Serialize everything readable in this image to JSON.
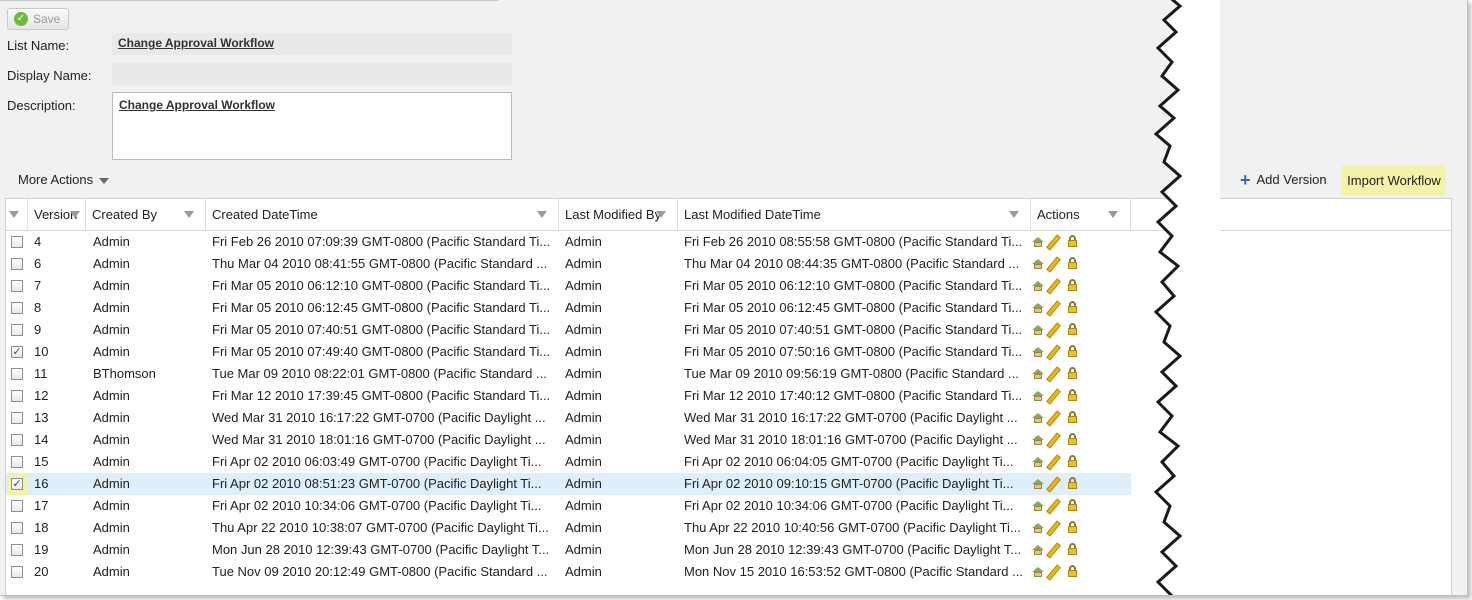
{
  "toolbar": {
    "save_label": "Save"
  },
  "form": {
    "list_name_label": "List Name:",
    "list_name_value": "Change Approval Workflow",
    "display_name_label": "Display Name:",
    "display_name_value": "",
    "description_label": "Description:",
    "description_value": "Change Approval Workflow"
  },
  "actions_bar": {
    "more_actions": "More Actions",
    "add_version": "Add Version",
    "import_workflow": "Import Workflow"
  },
  "grid": {
    "columns": [
      "Version",
      "Created By",
      "Created DateTime",
      "Last Modified By",
      "Last Modified DateTime",
      "Actions"
    ],
    "rows": [
      {
        "checked": false,
        "version": "4",
        "created_by": "Admin",
        "created": "Fri Feb 26 2010 07:09:39 GMT-0800 (Pacific Standard Ti...",
        "modified_by": "Admin",
        "modified": "Fri Feb 26 2010 08:55:58 GMT-0800 (Pacific Standard Ti..."
      },
      {
        "checked": false,
        "version": "6",
        "created_by": "Admin",
        "created": "Thu Mar 04 2010 08:41:55 GMT-0800 (Pacific Standard ...",
        "modified_by": "Admin",
        "modified": "Thu Mar 04 2010 08:44:35 GMT-0800 (Pacific Standard ..."
      },
      {
        "checked": false,
        "version": "7",
        "created_by": "Admin",
        "created": "Fri Mar 05 2010 06:12:10 GMT-0800 (Pacific Standard Ti...",
        "modified_by": "Admin",
        "modified": "Fri Mar 05 2010 06:12:10 GMT-0800 (Pacific Standard Ti..."
      },
      {
        "checked": false,
        "version": "8",
        "created_by": "Admin",
        "created": "Fri Mar 05 2010 06:12:45 GMT-0800 (Pacific Standard Ti...",
        "modified_by": "Admin",
        "modified": "Fri Mar 05 2010 06:12:45 GMT-0800 (Pacific Standard Ti..."
      },
      {
        "checked": false,
        "version": "9",
        "created_by": "Admin",
        "created": "Fri Mar 05 2010 07:40:51 GMT-0800 (Pacific Standard Ti...",
        "modified_by": "Admin",
        "modified": "Fri Mar 05 2010 07:40:51 GMT-0800 (Pacific Standard Ti..."
      },
      {
        "checked": true,
        "version": "10",
        "created_by": "Admin",
        "created": "Fri Mar 05 2010 07:49:40 GMT-0800 (Pacific Standard Ti...",
        "modified_by": "Admin",
        "modified": "Fri Mar 05 2010 07:50:16 GMT-0800 (Pacific Standard Ti..."
      },
      {
        "checked": false,
        "version": "11",
        "created_by": "BThomson",
        "created": "Tue Mar 09 2010 08:22:01 GMT-0800 (Pacific Standard ...",
        "modified_by": "Admin",
        "modified": "Tue Mar 09 2010 09:56:19 GMT-0800 (Pacific Standard ..."
      },
      {
        "checked": false,
        "version": "12",
        "created_by": "Admin",
        "created": "Fri Mar 12 2010 17:39:45 GMT-0800 (Pacific Standard Ti...",
        "modified_by": "Admin",
        "modified": "Fri Mar 12 2010 17:40:12 GMT-0800 (Pacific Standard Ti..."
      },
      {
        "checked": false,
        "version": "13",
        "created_by": "Admin",
        "created": "Wed Mar 31 2010 16:17:22 GMT-0700 (Pacific Daylight ...",
        "modified_by": "Admin",
        "modified": "Wed Mar 31 2010 16:17:22 GMT-0700 (Pacific Daylight ..."
      },
      {
        "checked": false,
        "version": "14",
        "created_by": "Admin",
        "created": "Wed Mar 31 2010 18:01:16 GMT-0700 (Pacific Daylight ...",
        "modified_by": "Admin",
        "modified": "Wed Mar 31 2010 18:01:16 GMT-0700 (Pacific Daylight ..."
      },
      {
        "checked": false,
        "version": "15",
        "created_by": "Admin",
        "created": "Fri Apr 02 2010 06:03:49 GMT-0700 (Pacific Daylight Ti...",
        "modified_by": "Admin",
        "modified": "Fri Apr 02 2010 06:04:05 GMT-0700 (Pacific Daylight Ti..."
      },
      {
        "checked": true,
        "version": "16",
        "created_by": "Admin",
        "created": "Fri Apr 02 2010 08:51:23 GMT-0700 (Pacific Daylight Ti...",
        "modified_by": "Admin",
        "modified": "Fri Apr 02 2010 09:10:15 GMT-0700 (Pacific Daylight Ti..."
      },
      {
        "checked": false,
        "version": "17",
        "created_by": "Admin",
        "created": "Fri Apr 02 2010 10:34:06 GMT-0700 (Pacific Daylight Ti...",
        "modified_by": "Admin",
        "modified": "Fri Apr 02 2010 10:34:06 GMT-0700 (Pacific Daylight Ti..."
      },
      {
        "checked": false,
        "version": "18",
        "created_by": "Admin",
        "created": "Thu Apr 22 2010 10:38:07 GMT-0700 (Pacific Daylight Ti...",
        "modified_by": "Admin",
        "modified": "Thu Apr 22 2010 10:40:56 GMT-0700 (Pacific Daylight Ti..."
      },
      {
        "checked": false,
        "version": "19",
        "created_by": "Admin",
        "created": "Mon Jun 28 2010 12:39:43 GMT-0700 (Pacific Daylight T...",
        "modified_by": "Admin",
        "modified": "Mon Jun 28 2010 12:39:43 GMT-0700 (Pacific Daylight T..."
      },
      {
        "checked": false,
        "version": "20",
        "created_by": "Admin",
        "created": "Tue Nov 09 2010 20:12:49 GMT-0800 (Pacific Standard ...",
        "modified_by": "Admin",
        "modified": "Mon Nov 15 2010 16:53:52 GMT-0800 (Pacific Standard ..."
      }
    ],
    "selected_row": 11,
    "highlight_color": "#f3f2a8",
    "selected_color": "#dfeefb"
  },
  "icons": {
    "save": "check-circle-icon",
    "add": "plus-icon",
    "row_actions": [
      "home-icon",
      "pencil-icon",
      "lock-icon"
    ]
  }
}
